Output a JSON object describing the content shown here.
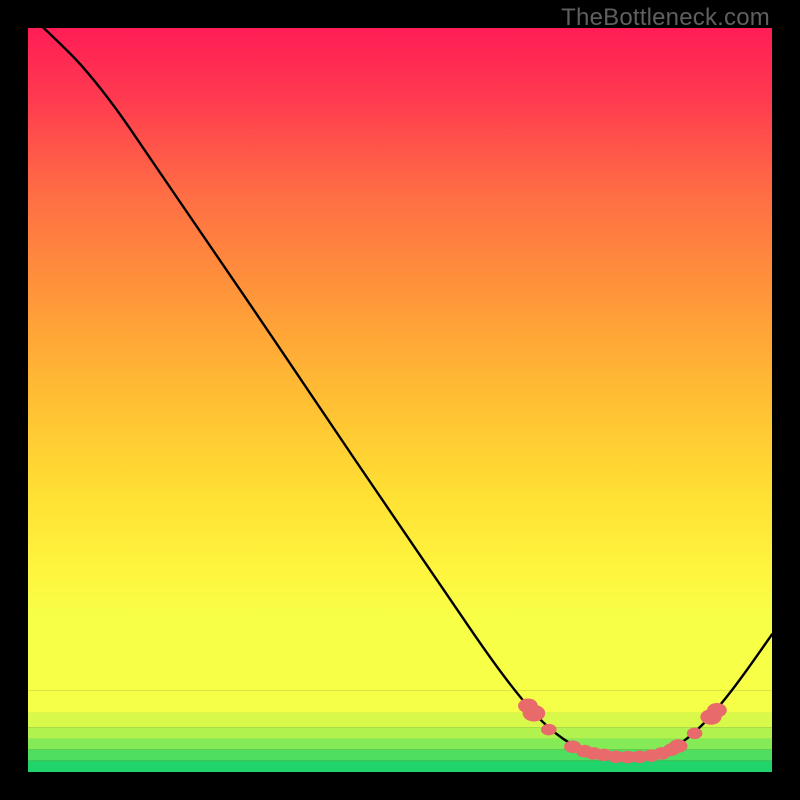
{
  "watermark": "TheBottleneck.com",
  "chart_data": {
    "type": "line",
    "title": "",
    "xlabel": "",
    "ylabel": "",
    "xlim": [
      0,
      100
    ],
    "ylim": [
      0,
      100
    ],
    "grid": false,
    "curve_description": "Bottleneck curve: steep descent from top-left to a flat trough near x≈74–88, then rises toward the right edge",
    "curve": [
      {
        "x": 0,
        "y": 102
      },
      {
        "x": 5,
        "y": 97.3
      },
      {
        "x": 8,
        "y": 94.1
      },
      {
        "x": 12,
        "y": 89.0
      },
      {
        "x": 16,
        "y": 83.1
      },
      {
        "x": 24,
        "y": 71.4
      },
      {
        "x": 32,
        "y": 59.7
      },
      {
        "x": 40,
        "y": 47.8
      },
      {
        "x": 48,
        "y": 36.0
      },
      {
        "x": 56,
        "y": 24.3
      },
      {
        "x": 62,
        "y": 15.5
      },
      {
        "x": 66,
        "y": 10.2
      },
      {
        "x": 69,
        "y": 6.8
      },
      {
        "x": 72,
        "y": 4.3
      },
      {
        "x": 75,
        "y": 2.7
      },
      {
        "x": 78,
        "y": 2.1
      },
      {
        "x": 81,
        "y": 2.0
      },
      {
        "x": 84,
        "y": 2.2
      },
      {
        "x": 87,
        "y": 3.3
      },
      {
        "x": 90,
        "y": 5.6
      },
      {
        "x": 93,
        "y": 8.9
      },
      {
        "x": 96,
        "y": 12.8
      },
      {
        "x": 100,
        "y": 18.5
      }
    ],
    "markers": [
      {
        "x": 67.2,
        "y": 8.9,
        "r": 1.4
      },
      {
        "x": 68.0,
        "y": 7.9,
        "r": 1.6
      },
      {
        "x": 70.0,
        "y": 5.7,
        "r": 1.1
      },
      {
        "x": 73.2,
        "y": 3.4,
        "r": 1.2
      },
      {
        "x": 74.8,
        "y": 2.8,
        "r": 1.2
      },
      {
        "x": 76.0,
        "y": 2.5,
        "r": 1.2
      },
      {
        "x": 77.4,
        "y": 2.3,
        "r": 1.2
      },
      {
        "x": 79.0,
        "y": 2.05,
        "r": 1.2
      },
      {
        "x": 80.6,
        "y": 2.0,
        "r": 1.2
      },
      {
        "x": 82.2,
        "y": 2.05,
        "r": 1.2
      },
      {
        "x": 83.8,
        "y": 2.2,
        "r": 1.2
      },
      {
        "x": 85.2,
        "y": 2.5,
        "r": 1.2
      },
      {
        "x": 86.5,
        "y": 3.0,
        "r": 1.2
      },
      {
        "x": 87.4,
        "y": 3.5,
        "r": 1.3
      },
      {
        "x": 89.6,
        "y": 5.2,
        "r": 1.1
      },
      {
        "x": 91.8,
        "y": 7.4,
        "r": 1.5
      },
      {
        "x": 92.6,
        "y": 8.3,
        "r": 1.4
      }
    ],
    "bands": [
      {
        "y0": 0,
        "y1": 1.5,
        "color": "#20d36a"
      },
      {
        "y0": 1.5,
        "y1": 3.0,
        "color": "#4fde5f"
      },
      {
        "y0": 3.0,
        "y1": 4.5,
        "color": "#84ea55"
      },
      {
        "y0": 4.5,
        "y1": 6.0,
        "color": "#b2f24e"
      },
      {
        "y0": 6.0,
        "y1": 8.0,
        "color": "#d9f94a"
      },
      {
        "y0": 8.0,
        "y1": 11.0,
        "color": "#f6ff48"
      }
    ],
    "gradient_stops": [
      {
        "offset": 0,
        "color": "#ff1d55"
      },
      {
        "offset": 0.1,
        "color": "#ff3850"
      },
      {
        "offset": 0.25,
        "color": "#ff6d44"
      },
      {
        "offset": 0.4,
        "color": "#ff953a"
      },
      {
        "offset": 0.55,
        "color": "#ffbc33"
      },
      {
        "offset": 0.7,
        "color": "#ffdf33"
      },
      {
        "offset": 0.82,
        "color": "#fff53e"
      },
      {
        "offset": 0.89,
        "color": "#f7ff47"
      }
    ],
    "marker_color": "#e86a6a",
    "curve_color": "#000000"
  }
}
